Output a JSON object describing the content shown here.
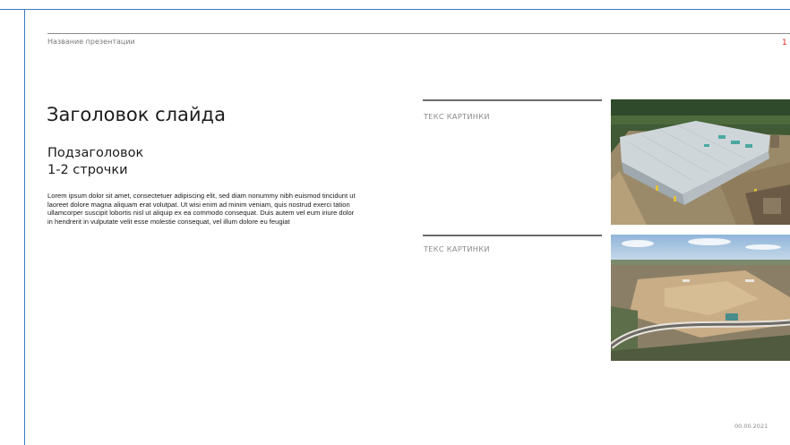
{
  "header": {
    "presentation_name": "Название презентации",
    "page_number": "1"
  },
  "content": {
    "title": "Заголовок слайда",
    "subtitle_lines": [
      "Подзаголовок",
      "1-2 строчки"
    ],
    "body": "Lorem ipsum dolor sit amet, consectetuer adipiscing elit, sed diam nonummy nibh euismod tincidunt ut laoreet dolore magna aliquam erat volutpat. Ut wisi enim ad minim veniam, quis nostrud exerci tation ullamcorper suscipit lobortis nisl ut aliquip ex ea commodo consequat. Duis autem vel eum iriure dolor in hendrerit in vulputate velit esse molestie consequat, vel illum dolore eu feugiat"
  },
  "images": [
    {
      "caption": "ТЕКС КАРТИНКИ",
      "depicts": "aerial photo of a large industrial building under construction"
    },
    {
      "caption": "ТЕКС КАРТИНКИ",
      "depicts": "aerial photo of a cleared construction site with a curved road"
    }
  ],
  "footer": {
    "date": "00.00.2021"
  },
  "colors": {
    "frame": "#3a7bbf",
    "page_number": "#e02020",
    "muted_text": "#8a8a8a"
  }
}
